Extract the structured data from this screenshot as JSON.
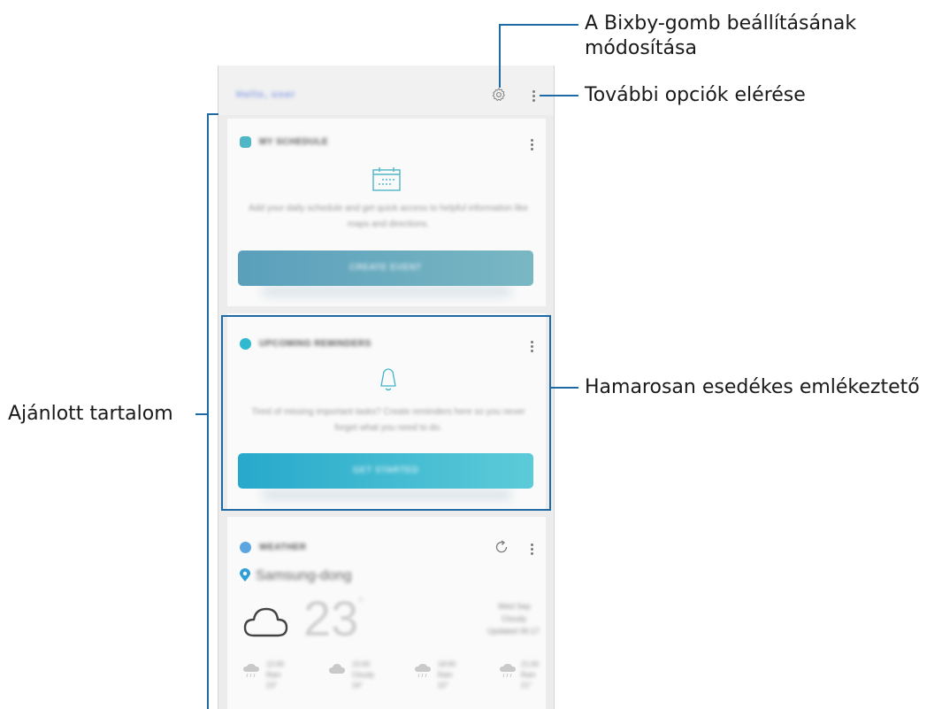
{
  "app": {
    "title": "Hello, user"
  },
  "cards": [
    {
      "title": "MY SCHEDULE",
      "text": "Add your daily schedule and get quick access to helpful information like maps and directions.",
      "button": "CREATE EVENT",
      "icon": "calendar-icon",
      "accent": "#4fb6c6"
    },
    {
      "title": "UPCOMING REMINDERS",
      "text": "Tired of missing important tasks? Create reminders here so you never forget what you need to do.",
      "button": "GET STARTED",
      "icon": "bell-icon",
      "accent": "#2fbad0"
    },
    {
      "title": "WEATHER",
      "location": "Samsung-dong",
      "temperature": "23",
      "temp_unit": "°",
      "details": [
        "Wed Sep",
        "Cloudy",
        "Updated 06:17"
      ],
      "forecast": [
        {
          "time": "12:00",
          "desc": "Rain",
          "temp": "23°"
        },
        {
          "time": "15:00",
          "desc": "Cloudy",
          "temp": "24°"
        },
        {
          "time": "18:00",
          "desc": "Rain",
          "temp": "22°"
        },
        {
          "time": "21:00",
          "desc": "Rain",
          "temp": "21°"
        }
      ],
      "icon": "weather-icon"
    }
  ],
  "annotations": {
    "settings": [
      "A Bixby-gomb beállításának",
      "módosítása"
    ],
    "more_options": "További opciók elérése",
    "reminder": "Hamarosan esedékes emlékeztető",
    "recommended": "Ajánlott tartalom"
  },
  "colors": {
    "callout_line": "#1d6aa5",
    "button_schedule_start": "#5a9fbb",
    "button_schedule_end": "#79b7c3",
    "button_reminder_start": "#27a9cb",
    "button_reminder_end": "#5ccbd8"
  }
}
